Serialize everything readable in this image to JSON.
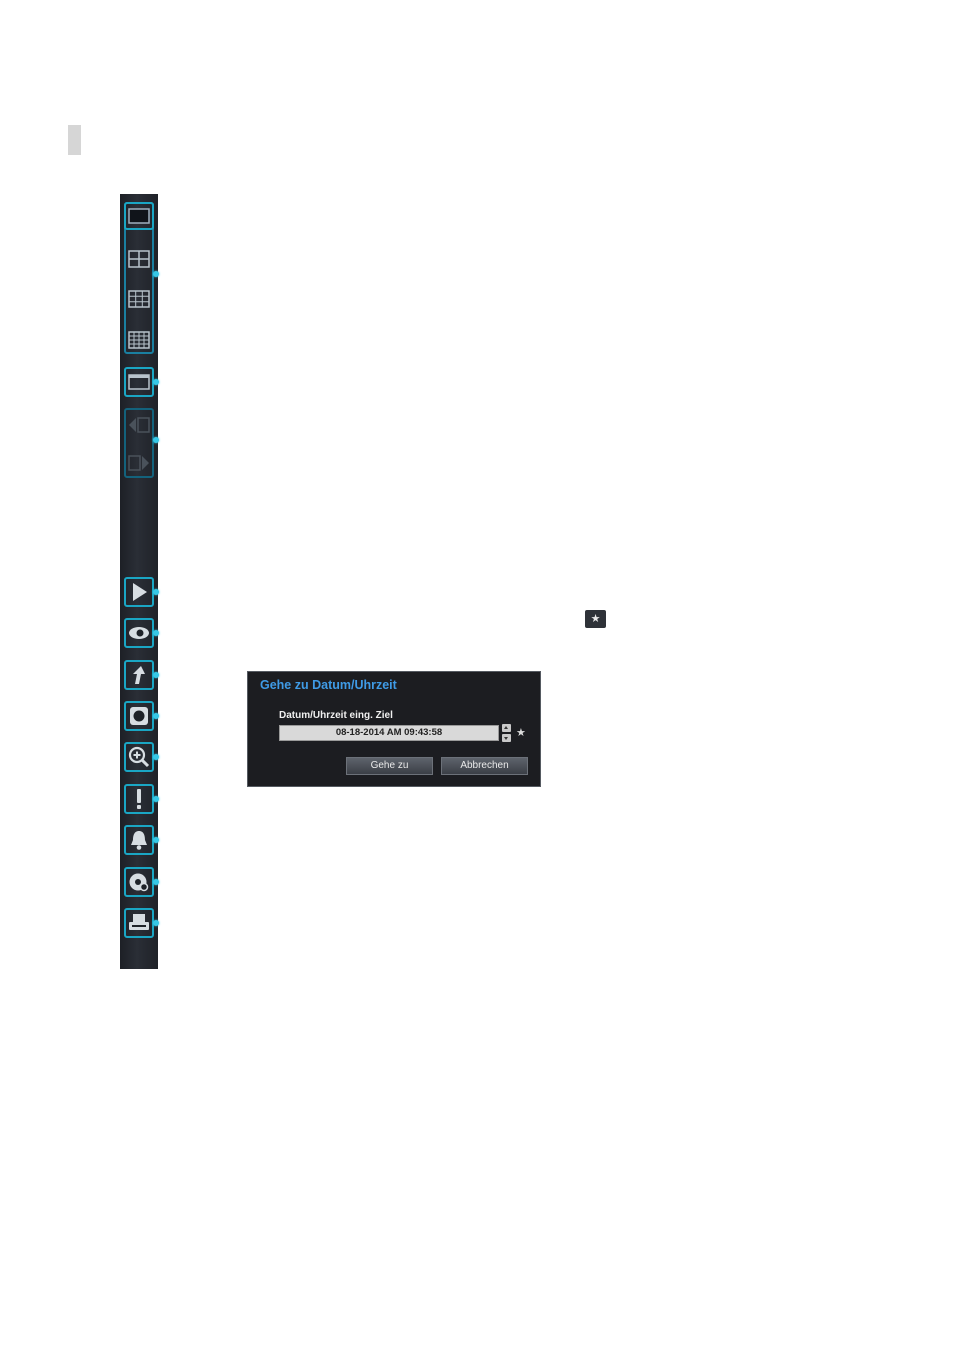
{
  "toolbar": {
    "items": [
      {
        "name": "single-view-icon"
      },
      {
        "name": "quad-view-icon"
      },
      {
        "name": "nine-split-icon"
      },
      {
        "name": "sixteen-split-icon"
      },
      {
        "name": "window-sequence-icon"
      },
      {
        "name": "previous-group-icon"
      },
      {
        "name": "next-group-icon"
      },
      {
        "name": "play-icon"
      },
      {
        "name": "eye-icon"
      },
      {
        "name": "export-arrow-icon"
      },
      {
        "name": "snapshot-icon"
      },
      {
        "name": "zoom-icon"
      },
      {
        "name": "event-alert-icon"
      },
      {
        "name": "alarm-bell-icon"
      },
      {
        "name": "search-disc-icon"
      },
      {
        "name": "print-icon"
      }
    ]
  },
  "inline_icon": {
    "glyph": "★"
  },
  "dialog": {
    "title": "Gehe zu Datum/Uhrzeit",
    "field_label": "Datum/Uhrzeit eing. Ziel",
    "datetime_value": "08-18-2014  AM 09:43:58",
    "star_glyph": "★",
    "go_button": "Gehe zu",
    "cancel_button": "Abbrechen"
  },
  "colors": {
    "accent": "#1aa6c4",
    "title_blue": "#3f9be6",
    "dialog_bg": "#1c1d21"
  }
}
